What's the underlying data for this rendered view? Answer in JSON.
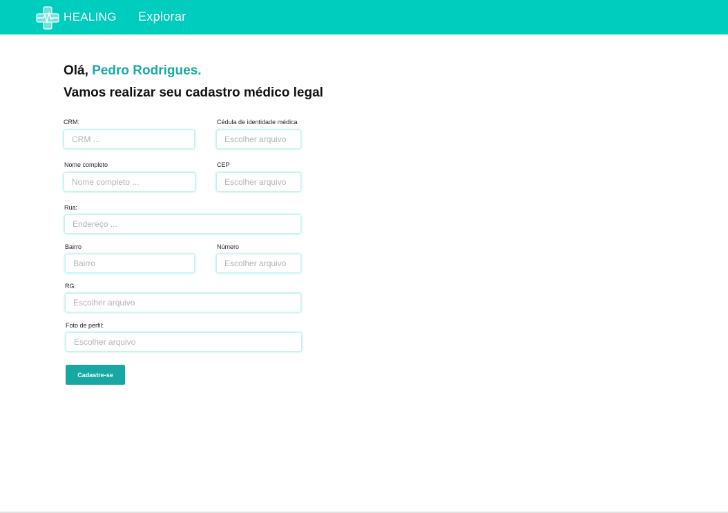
{
  "header": {
    "brand": "HEALING",
    "nav_link": "Explorar",
    "logo_icon": "medical-cross-heartbeat-icon",
    "bg_color": "#00cdbd"
  },
  "greeting": {
    "prefix": "Olá, ",
    "user_name": "Pedro Rodrigues.",
    "subtitle": "Vamos realizar seu cadastro médico legal",
    "accent_color": "#1aa9a5"
  },
  "form": {
    "crm": {
      "label": "CRM:",
      "placeholder": "CRM ..."
    },
    "cedula": {
      "label": "Cédula de identidade médica",
      "placeholder": "Escolher arquivo"
    },
    "nome": {
      "label": "Nome completo",
      "placeholder": "Nome completo ..."
    },
    "cep": {
      "label": "CEP",
      "placeholder": "Escolher arquivo"
    },
    "rua": {
      "label": "Rua:",
      "placeholder": "Endereço ..."
    },
    "bairro": {
      "label": "Bairro",
      "placeholder": "Bairro"
    },
    "numero": {
      "label": "Número",
      "placeholder": "Escolher arquivo"
    },
    "rg": {
      "label": "RG:",
      "placeholder": "Escolher arquivo"
    },
    "foto": {
      "label": "Foto de perfil:",
      "placeholder": "Escolher arquivo"
    },
    "submit_label": "Cadastre-se",
    "submit_color": "#17a8a3"
  }
}
